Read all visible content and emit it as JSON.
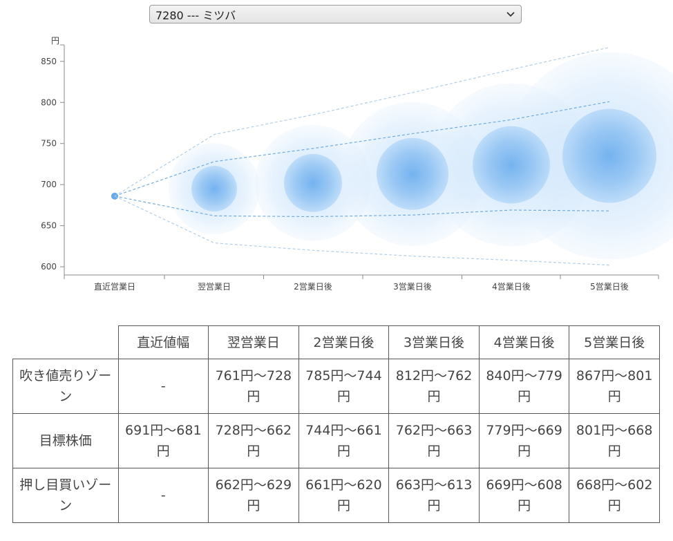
{
  "selector": {
    "value": "7280 --- ミツバ"
  },
  "colors": {
    "bubble": "#4a9ae6",
    "line": "#6aa6d6",
    "axis": "#888888"
  },
  "chart_data": {
    "type": "scatter",
    "yunit": "円",
    "ylim": [
      590,
      870
    ],
    "yticks": [
      600,
      650,
      700,
      750,
      800,
      850
    ],
    "categories": [
      "直近営業日",
      "翌営業日",
      "2営業日後",
      "3営業日後",
      "4営業日後",
      "5営業日後"
    ],
    "series": [
      {
        "values": [
          686,
          695,
          702,
          713,
          724,
          735
        ]
      },
      {
        "values": [
          686,
          728,
          744,
          762,
          779,
          801
        ]
      },
      {
        "values": [
          686,
          662,
          661,
          663,
          669,
          668
        ]
      },
      {
        "values": [
          686,
          761,
          785,
          812,
          840,
          867
        ]
      },
      {
        "values": [
          686,
          629,
          620,
          613,
          608,
          602
        ]
      }
    ],
    "inner_radius": [
      0,
      33,
      42,
      52,
      56,
      68
    ],
    "outer_radius": [
      0,
      66,
      84,
      104,
      118,
      150
    ],
    "grid": false,
    "legend": "none"
  },
  "table": {
    "headers": [
      "",
      "直近値幅",
      "翌営業日",
      "2営業日後",
      "3営業日後",
      "4営業日後",
      "5営業日後"
    ],
    "rows": [
      {
        "label": "吹き値売りゾーン",
        "cells": [
          "-",
          "761円～728円",
          "785円～744円",
          "812円～762円",
          "840円～779円",
          "867円～801円"
        ]
      },
      {
        "label": "目標株価",
        "cells": [
          "691円～681円",
          "728円～662円",
          "744円～661円",
          "762円～663円",
          "779円～669円",
          "801円～668円"
        ]
      },
      {
        "label": "押し目買いゾーン",
        "cells": [
          "-",
          "662円～629円",
          "661円～620円",
          "663円～613円",
          "669円～608円",
          "668円～602円"
        ]
      }
    ]
  }
}
